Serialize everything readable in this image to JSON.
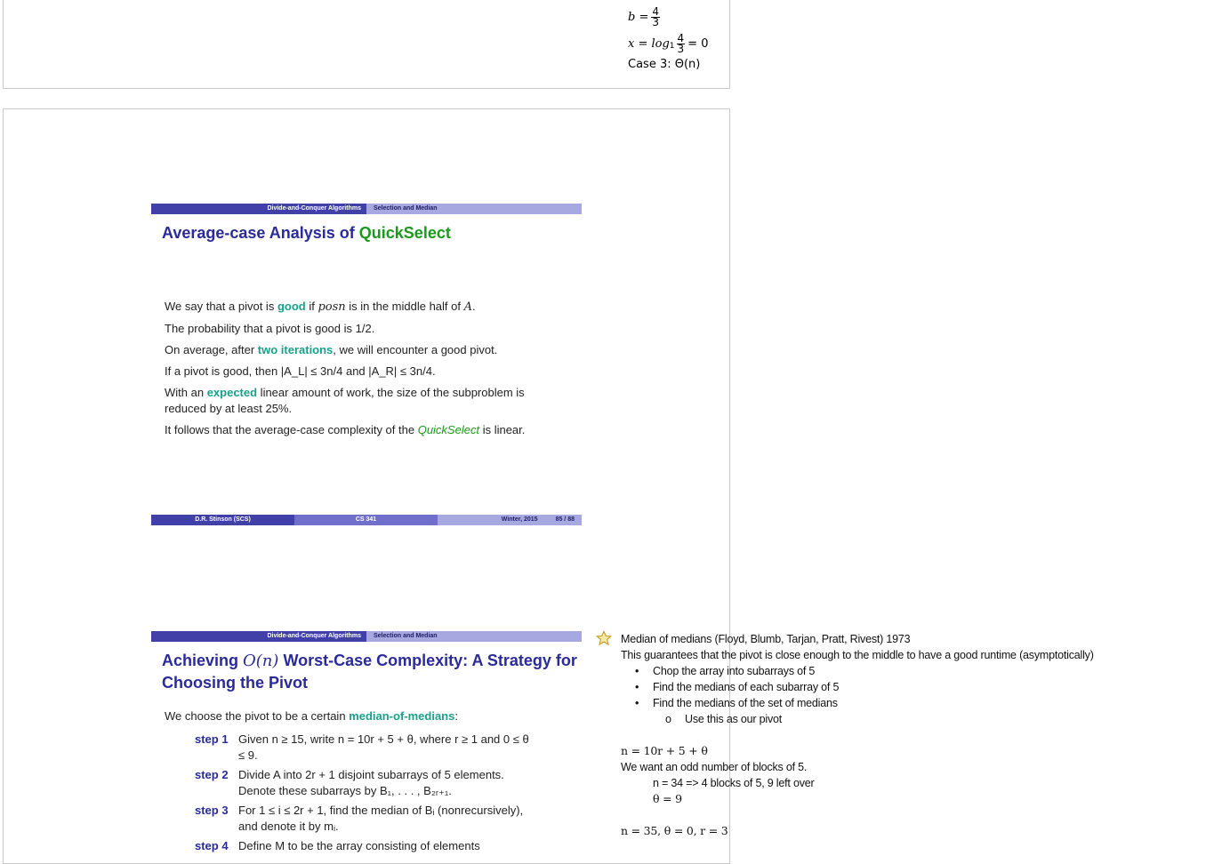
{
  "top_math": {
    "b_lhs": "b =",
    "b_num": "4",
    "b_den": "3",
    "x_lhs": "x = log",
    "x_sub": "1",
    "x_num": "4",
    "x_den": "3",
    "x_rhs": "= 0",
    "case": "Case 3: Θ(n)"
  },
  "slide1": {
    "header_left": "Divide-and-Conquer Algorithms",
    "header_right": "Selection and Median",
    "title_part1": "Average-case Analysis of ",
    "title_part2": "QuickSelect",
    "l1a": "We say that a pivot is ",
    "l1b": "good",
    "l1c": " if ",
    "l1d": "posn",
    "l1e": " is in the middle half of ",
    "l1f": "A",
    "l1g": ".",
    "l2": "The probability that a pivot is good is 1/2.",
    "l3a": "On average, after ",
    "l3b": "two iterations",
    "l3c": ", we will encounter a good pivot.",
    "l4": "If a pivot is good, then |A_L| ≤ 3n/4 and |A_R| ≤ 3n/4.",
    "l5a": "With an ",
    "l5b": "expected",
    "l5c": " linear amount of work, the size of the subproblem is reduced by at least 25%.",
    "l6a": "It follows that the average-case complexity of the ",
    "l6b": "QuickSelect",
    "l6c": " is linear.",
    "footer_author": "D.R. Stinson (SCS)",
    "footer_course": "CS 341",
    "footer_term": "Winter, 2015",
    "footer_page": "85 / 88"
  },
  "slide2": {
    "header_left": "Divide-and-Conquer Algorithms",
    "header_right": "Selection and Median",
    "title_a": "Achieving ",
    "title_b": "O(n)",
    "title_c": " Worst-Case Complexity: A Strategy for Choosing the Pivot",
    "intro_a": "We choose the pivot to be a certain ",
    "intro_b": "median-of-medians",
    "intro_c": ":",
    "steps": [
      {
        "label": "step 1",
        "text": "Given n ≥ 15, write n = 10r + 5 + θ, where r ≥ 1 and 0 ≤ θ ≤ 9."
      },
      {
        "label": "step 2",
        "text": "Divide A into 2r + 1 disjoint subarrays of 5 elements. Denote these subarrays by B₁, . . . , B₂ᵣ₊₁."
      },
      {
        "label": "step 3",
        "text": "For 1 ≤ i ≤ 2r + 1, find the median of Bᵢ (nonrecursively), and denote it by mᵢ."
      },
      {
        "label": "step 4",
        "text": "Define M to be the array consisting of elements"
      }
    ]
  },
  "notes": {
    "title": "Median of medians (Floyd, Blumb, Tarjan, Pratt, Rivest) 1973",
    "line2": "This guarantees that the pivot is close enough to the middle to have a good runtime (asymptotically)",
    "bullets": [
      "Chop the array into subarrays of 5",
      "Find the medians of each subarray of 5",
      "Find the medians of the set of medians"
    ],
    "sub_bullet": "Use this as our pivot",
    "sub_marker": "o",
    "bullet_marker": "•",
    "eq1": "n = 10r + 5 + θ",
    "line_odd": "We want an odd number of blocks of 5.",
    "ex1": "n = 34 => 4 blocks of 5, 9 left over",
    "ex2": "θ = 9",
    "eq2": "n = 35, θ = 0, r = 3"
  }
}
